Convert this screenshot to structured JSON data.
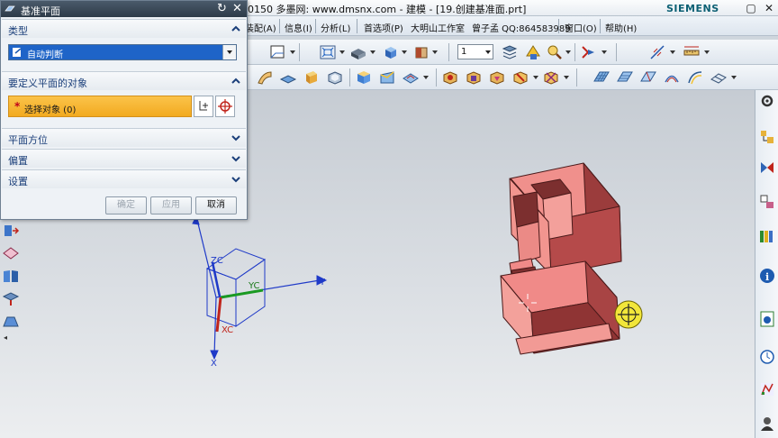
{
  "window": {
    "title": "0150 多墨网: www.dmsnx.com - 建模 - [19.创建基准面.prt]",
    "brand": "SIEMENS",
    "controls": [
      "▢",
      "✕"
    ]
  },
  "menu": {
    "items": [
      "装配(A)",
      "信息(I)",
      "分析(L)",
      "首选项(P)",
      "大明山工作室",
      "曾子孟 QQ:864583989",
      "窗口(O)",
      "帮助(H)"
    ]
  },
  "toolbar": {
    "layer_value": "1"
  },
  "dialog": {
    "title": "基准平面",
    "groups": {
      "type": {
        "label": "类型",
        "expanded": true,
        "selected": "自动判断"
      },
      "objects": {
        "label": "要定义平面的对象",
        "expanded": true,
        "select_label": "选择对象 (0)",
        "required_mark": "*"
      },
      "orientation": {
        "label": "平面方位",
        "expanded": false
      },
      "offset": {
        "label": "偏置",
        "expanded": false
      },
      "settings": {
        "label": "设置",
        "expanded": false
      }
    },
    "buttons": {
      "ok": "确定",
      "apply": "应用",
      "cancel": "取消"
    }
  },
  "csys": {
    "zc": "ZC",
    "yc": "YC",
    "xc": "XC",
    "y": "Y",
    "x": "X"
  },
  "colors": {
    "part_face": "#f08a88",
    "part_side": "#9b3c3c",
    "part_edge": "#4a1a1a",
    "accent_yellow": "#f2b12a",
    "csys_blue": "#1f3ac8",
    "dialog_header": "#3a4857"
  }
}
